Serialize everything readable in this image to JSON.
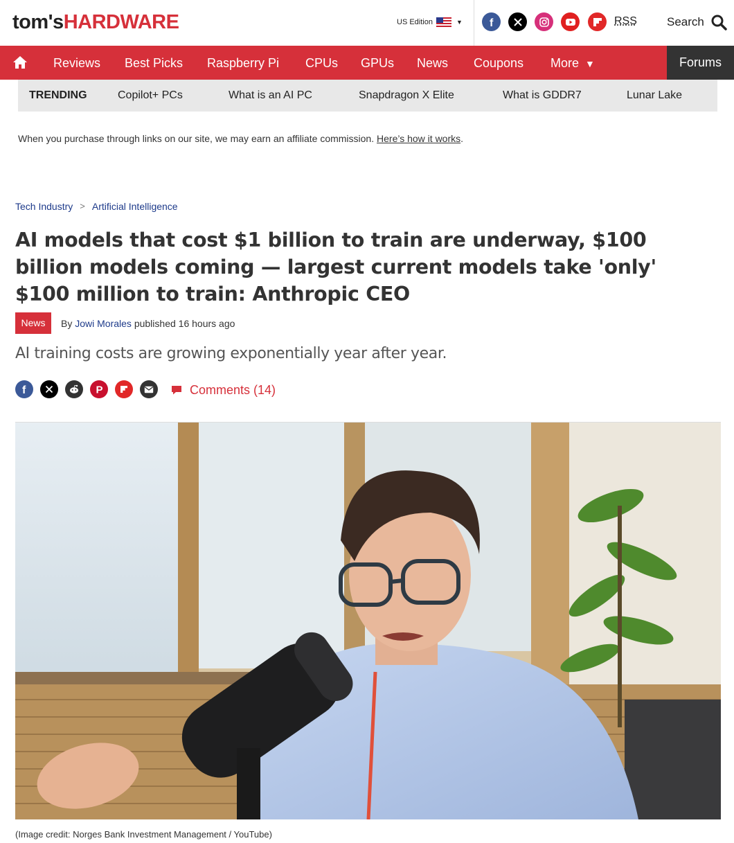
{
  "header": {
    "logo_part1": "tom's",
    "logo_part2": "HARDWARE",
    "edition": "US Edition",
    "rss": "RSS",
    "search": "Search",
    "social_icons": [
      "facebook-icon",
      "x-icon",
      "instagram-icon",
      "youtube-icon",
      "flipboard-icon"
    ]
  },
  "nav": {
    "items": [
      "Reviews",
      "Best Picks",
      "Raspberry Pi",
      "CPUs",
      "GPUs",
      "News",
      "Coupons",
      "More"
    ],
    "forums": "Forums"
  },
  "trending": {
    "label": "TRENDING",
    "items": [
      "Copilot+ PCs",
      "What is an AI PC",
      "Snapdragon X Elite",
      "What is GDDR7",
      "Lunar Lake"
    ]
  },
  "affiliate": {
    "text": "When you purchase through links on our site, we may earn an affiliate commission.",
    "link": "Here’s how it works",
    "tail": "."
  },
  "article": {
    "breadcrumb": [
      "Tech Industry",
      "Artificial Intelligence"
    ],
    "breadcrumb_sep": ">",
    "title": "AI models that cost $1 billion to train are underway, $100 billion models coming — largest current models take 'only' $100 million to train: Anthropic CEO",
    "badge": "News",
    "by": "By",
    "author": "Jowi Morales",
    "published": "published 16 hours ago",
    "subtitle": "AI training costs are growing exponentially year after year.",
    "comments": "Comments (14)",
    "share_icons": [
      "facebook-icon",
      "x-icon",
      "reddit-icon",
      "pinterest-icon",
      "flipboard-icon",
      "email-icon"
    ],
    "image_credit": "(Image credit: Norges Bank Investment Management / YouTube)"
  },
  "colors": {
    "brand_red": "#d6303a",
    "link_blue": "#1d3a8a",
    "forums_bg": "#333333",
    "trending_bg": "#e8e8e8"
  }
}
